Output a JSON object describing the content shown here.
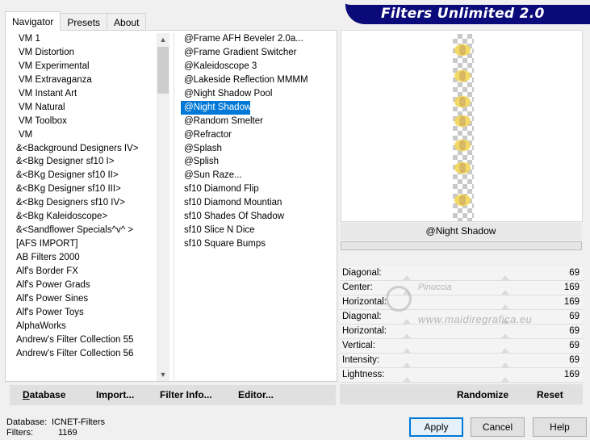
{
  "tabs": [
    {
      "label": "Navigator",
      "active": true
    },
    {
      "label": "Presets",
      "active": false
    },
    {
      "label": "About",
      "active": false
    }
  ],
  "logo": {
    "text": "Filters Unlimited 2.0"
  },
  "categories": [
    "VM 1",
    "VM Distortion",
    "VM Experimental",
    "VM Extravaganza",
    "VM Instant Art",
    "VM Natural",
    "VM Toolbox",
    "VM",
    "&<Background Designers IV>",
    "&<Bkg Designer sf10 I>",
    "&<BKg Designer sf10 II>",
    "&<BKg Designer sf10 III>",
    "&<Bkg Designers sf10 IV>",
    "&<Bkg Kaleidoscope>",
    "&<Sandflower Specials^v^ >",
    "[AFS IMPORT]",
    "AB Filters 2000",
    "Alf's Border FX",
    "Alf's Power Grads",
    "Alf's Power Sines",
    "Alf's Power Toys",
    "AlphaWorks",
    "Andrew's Filter Collection 55",
    "Andrew's Filter Collection 56"
  ],
  "filters": [
    "@Frame AFH Beveler 2.0a...",
    "@Frame Gradient Switcher",
    "@Kaleidoscope 3",
    "@Lakeside Reflection MMMM",
    "@Night Shadow Pool",
    "@Night Shadow",
    "@Random Smelter",
    "@Refractor",
    "@Splash",
    "@Splish",
    "@Sun Raze...",
    "sf10 Diamond Flip",
    "sf10 Diamond Mountian",
    "sf10 Shades Of Shadow",
    "sf10 Slice N Dice",
    "sf10 Square Bumps"
  ],
  "selected_filter_index": 5,
  "bottom_buttons": {
    "database": "Database",
    "import": "Import...",
    "filter_info": "Filter Info...",
    "editor": "Editor..."
  },
  "preview": {
    "filter_name": "@Night Shadow"
  },
  "params": [
    {
      "name": "Diagonal:",
      "value": "69"
    },
    {
      "name": "Center:",
      "value": "169"
    },
    {
      "name": "Horizontal:",
      "value": "169"
    },
    {
      "name": "Diagonal:",
      "value": "69"
    },
    {
      "name": "Horizontal:",
      "value": "69"
    },
    {
      "name": "Vertical:",
      "value": "69"
    },
    {
      "name": "Intensity:",
      "value": "69"
    },
    {
      "name": "Lightness:",
      "value": "169"
    }
  ],
  "param_buttons": {
    "randomize": "Randomize",
    "reset": "Reset"
  },
  "watermark": {
    "name": "Pinuccia",
    "url": "www.maidiregrafica.eu"
  },
  "status": {
    "database_label": "Database:",
    "database_value": "ICNET-Filters",
    "filters_label": "Filters:",
    "filters_value": "1169"
  },
  "dialog_buttons": {
    "apply": "Apply",
    "cancel": "Cancel",
    "help": "Help"
  },
  "colors": {
    "logo_bg": "#0a0a7a",
    "selection": "#0078d7"
  }
}
